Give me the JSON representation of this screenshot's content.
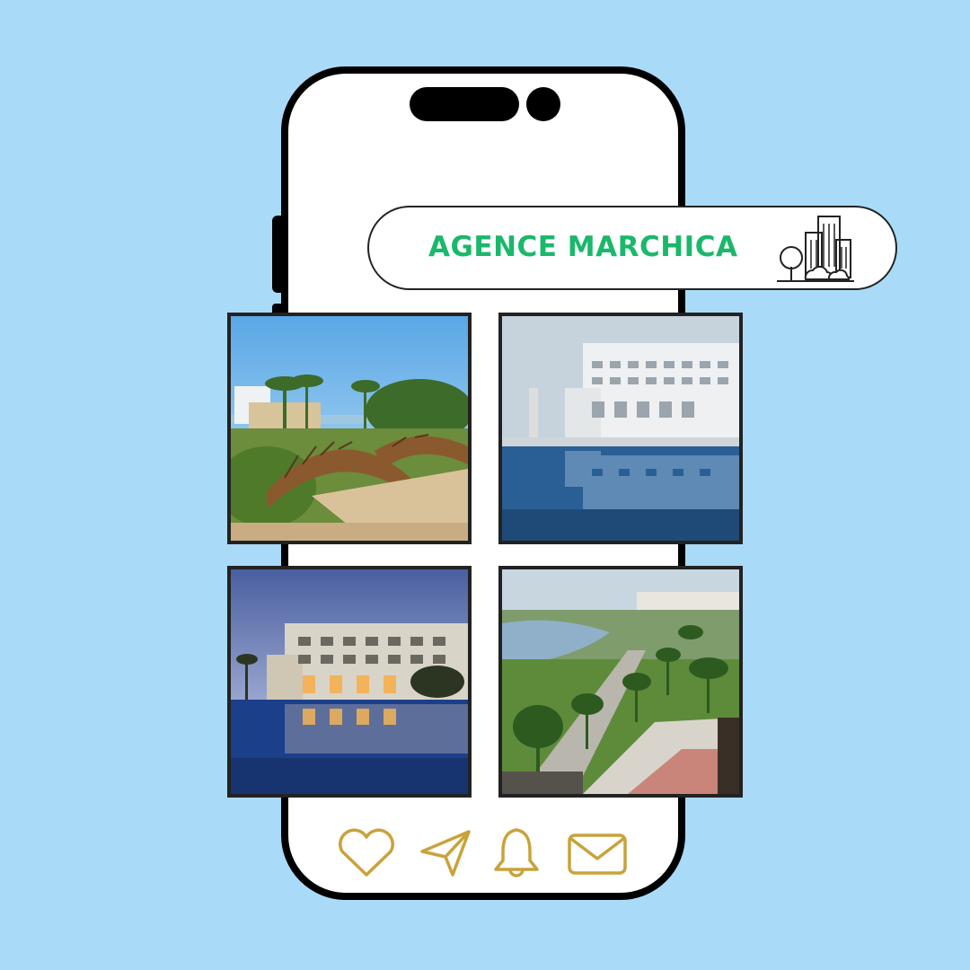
{
  "banner": {
    "title": "AGENCE MARCHICA",
    "icon": "city-buildings-icon"
  },
  "gallery": [
    {
      "name": "bridge-garden-photo"
    },
    {
      "name": "hotel-pool-day-photo"
    },
    {
      "name": "hotel-pool-dusk-photo"
    },
    {
      "name": "lagoon-promenade-photo"
    }
  ],
  "nav_icons": [
    "heart-icon",
    "send-icon",
    "bell-icon",
    "mail-icon"
  ],
  "colors": {
    "background": "#a9dbf9",
    "brand_green": "#1ab86a",
    "icon_gold": "#c9a23a"
  }
}
